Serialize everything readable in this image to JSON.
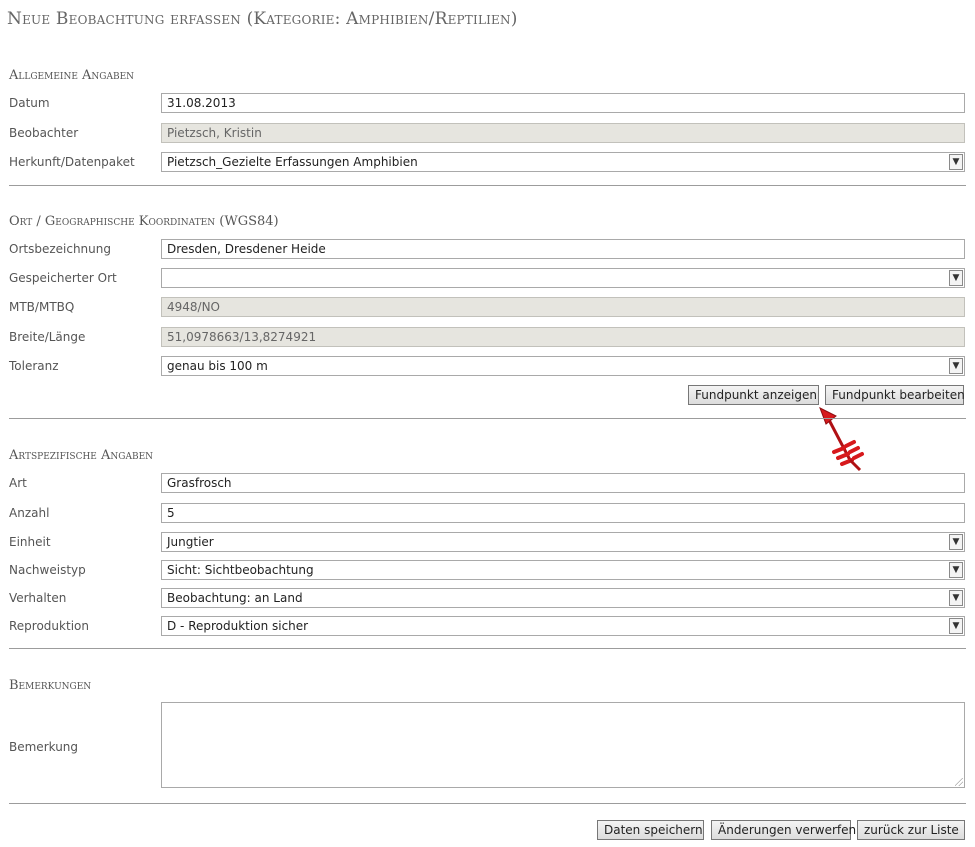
{
  "page": {
    "title": "Neue Beobachtung erfassen (Kategorie: Amphibien/Reptilien)"
  },
  "general": {
    "heading": "Allgemeine Angaben",
    "datum_label": "Datum",
    "datum_value": "31.08.2013",
    "beobachter_label": "Beobachter",
    "beobachter_value": "Pietzsch, Kristin",
    "herkunft_label": "Herkunft/Datenpaket",
    "herkunft_value": "Pietzsch_Gezielte Erfassungen Amphibien"
  },
  "location": {
    "heading": "Ort / Geographische Koordinaten (WGS84)",
    "ortsbezeichnung_label": "Ortsbezeichnung",
    "ortsbezeichnung_value": "Dresden, Dresdener Heide",
    "gespeichert_label": "Gespeicherter Ort",
    "gespeichert_value": "",
    "mtb_label": "MTB/MTBQ",
    "mtb_value": "4948/NO",
    "coords_label": "Breite/Länge",
    "coords_value": "51,0978663/13,8274921",
    "toleranz_label": "Toleranz",
    "toleranz_value": "genau bis 100 m",
    "show_button": "Fundpunkt anzeigen",
    "edit_button": "Fundpunkt bearbeiten"
  },
  "species": {
    "heading": "Artspezifische Angaben",
    "art_label": "Art",
    "art_value": "Grasfrosch",
    "anzahl_label": "Anzahl",
    "anzahl_value": "5",
    "einheit_label": "Einheit",
    "einheit_value": "Jungtier",
    "nachweistyp_label": "Nachweistyp",
    "nachweistyp_value": "Sicht: Sichtbeobachtung",
    "verhalten_label": "Verhalten",
    "verhalten_value": "Beobachtung: an Land",
    "reproduktion_label": "Reproduktion",
    "reproduktion_value": "D - Reproduktion sicher"
  },
  "remarks": {
    "heading": "Bemerkungen",
    "bemerkung_label": "Bemerkung",
    "bemerkung_value": ""
  },
  "actions": {
    "save": "Daten speichern",
    "discard": "Änderungen verwerfen",
    "back": "zurück zur Liste"
  },
  "icons": {
    "dropdown": "chevron-down-icon",
    "pointer": "red-arrow-icon",
    "resize": "resize-grip-icon"
  },
  "colors": {
    "readonly_bg": "#e6e5df",
    "arrow": "#d7191c"
  }
}
